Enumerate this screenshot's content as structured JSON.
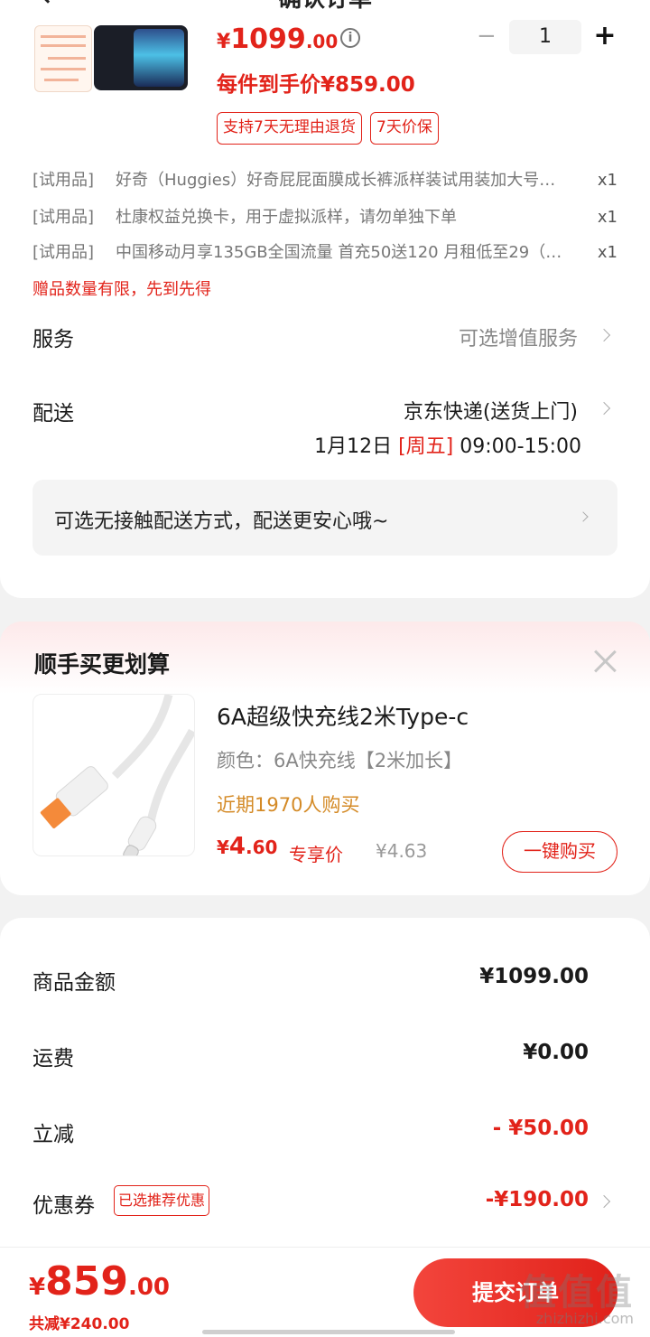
{
  "header": {
    "title": "确认订单"
  },
  "product": {
    "price_currency": "¥",
    "price_int": "1099",
    "price_dec": ".00",
    "quantity": "1",
    "arrival_price_label": "每件到手价¥859.00",
    "tags": [
      "支持7天无理由退货",
      "7天价保"
    ]
  },
  "trial_items": [
    {
      "label": "[试用品]",
      "name": "好奇（Huggies）好奇屁屁面膜成长裤派样装试用装加大号…",
      "qty": "x1"
    },
    {
      "label": "[试用品]",
      "name": "杜康权益兑换卡，用于虚拟派样，请勿单独下单",
      "qty": "x1"
    },
    {
      "label": "[试用品]",
      "name": "中国移动月享135GB全国流量 首充50送120 月租低至29（…",
      "qty": "x1"
    }
  ],
  "gift_note": "赠品数量有限，先到先得",
  "service": {
    "label": "服务",
    "value": "可选增值服务"
  },
  "delivery": {
    "label": "配送",
    "value": "京东快递(送货上门)",
    "date": "1月12日",
    "weekday": "[周五]",
    "time": "09:00-15:00"
  },
  "contactless": "可选无接触配送方式，配送更安心哦~",
  "addon": {
    "title": "顺手买更划算",
    "name": "6A超级快充线2米Type-c",
    "spec": "颜色：6A快充线【2米加长】",
    "buyers": "近期1970人购买",
    "price_currency": "¥",
    "price_int": "4",
    "price_dec": ".60",
    "exclusive": "专享价",
    "original": "¥4.63",
    "buy_button": "一键购买"
  },
  "summary": [
    {
      "label": "商品金额",
      "value": "¥1099.00",
      "red": false
    },
    {
      "label": "运费",
      "value": "¥0.00",
      "red": false
    },
    {
      "label": "立减",
      "value": "- ¥50.00",
      "red": true
    },
    {
      "label": "优惠券",
      "value": "-¥190.00",
      "red": true,
      "tag": "已选推荐优惠"
    }
  ],
  "footer": {
    "total_currency": "¥",
    "total_int": "859",
    "total_dec": ".00",
    "saved": "共减¥240.00",
    "submit": "提交订单"
  },
  "watermark": {
    "logo": "值值值",
    "site": "zhizhizhi.com"
  },
  "colors": {
    "accent": "#e2231a",
    "orange": "#d48a26",
    "background": "#f2f2f2"
  }
}
